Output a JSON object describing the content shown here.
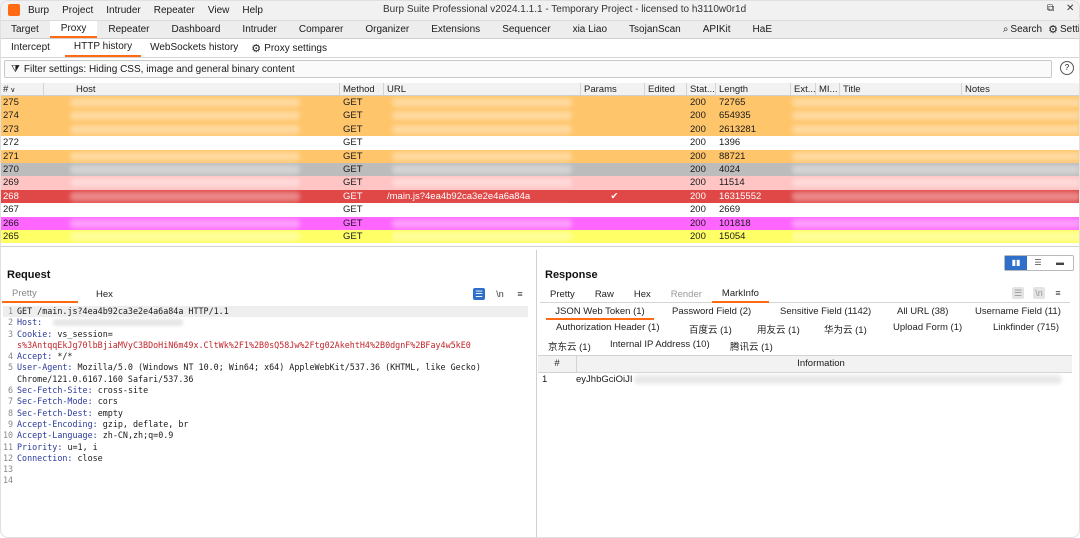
{
  "window": {
    "menu": [
      "Burp",
      "Project",
      "Intruder",
      "Repeater",
      "View",
      "Help"
    ],
    "title": "Burp Suite Professional v2024.1.1.1 - Temporary Project - licensed to h3110w0r1d",
    "controls": [
      "⧉",
      "✕"
    ]
  },
  "main_tabs": [
    "Target",
    "Proxy",
    "Repeater",
    "Dashboard",
    "Intruder",
    "Comparer",
    "Organizer",
    "Extensions",
    "Sequencer",
    "xia Liao",
    "TsojanScan",
    "APIKit",
    "HaE"
  ],
  "main_tab_active": "Proxy",
  "top_right": {
    "search_label": "Search",
    "settings_label": "Setti"
  },
  "sub_tabs": [
    "Intercept",
    "HTTP history",
    "WebSockets history"
  ],
  "proxy_settings_label": "Proxy settings",
  "filter_text": "Filter settings: Hiding CSS, image and general binary content",
  "help_icon": "?",
  "columns": [
    "#",
    "Host",
    "Method",
    "URL",
    "Params",
    "Edited",
    "Stat...",
    "Length",
    "Ext...",
    "MI...",
    "Title",
    "Notes"
  ],
  "rows": [
    {
      "num": "275",
      "method": "GET",
      "url": "",
      "params": "",
      "status": "200",
      "length": "72765",
      "color": "#ffc56a"
    },
    {
      "num": "274",
      "method": "GET",
      "url": "",
      "params": "",
      "status": "200",
      "length": "654935",
      "color": "#ffc56a"
    },
    {
      "num": "273",
      "method": "GET",
      "url": "",
      "params": "",
      "status": "200",
      "length": "2613281",
      "color": "#ffc56a"
    },
    {
      "num": "272",
      "method": "GET",
      "url": "",
      "params": "",
      "status": "200",
      "length": "1396",
      "color": "#ffffff"
    },
    {
      "num": "271",
      "method": "GET",
      "url": "",
      "params": "",
      "status": "200",
      "length": "88721",
      "color": "#ffc56a"
    },
    {
      "num": "270",
      "method": "GET",
      "url": "",
      "params": "",
      "status": "200",
      "length": "4024",
      "color": "#bcbcbc"
    },
    {
      "num": "269",
      "method": "GET",
      "url": "",
      "params": "",
      "status": "200",
      "length": "11514",
      "color": "#ffc4c4"
    },
    {
      "num": "268",
      "method": "GET",
      "url": "/main.js?4ea4b92ca3e2e4a6a84a",
      "params": "✔",
      "status": "200",
      "length": "16315552",
      "color": "#e04848",
      "selected": true
    },
    {
      "num": "267",
      "method": "GET",
      "url": "",
      "params": "",
      "status": "200",
      "length": "2669",
      "color": "#ffffff"
    },
    {
      "num": "266",
      "method": "GET",
      "url": "",
      "params": "",
      "status": "200",
      "length": "101818",
      "color": "#ff66ff"
    },
    {
      "num": "265",
      "method": "GET",
      "url": "",
      "params": "",
      "status": "200",
      "length": "15054",
      "color": "#ffff66"
    }
  ],
  "request": {
    "title": "Request",
    "tabs": [
      "Pretty",
      "Hex"
    ],
    "tool_icons": [
      "☰",
      "\\n",
      "≡"
    ],
    "lines": [
      {
        "n": "1",
        "key": "",
        "val": "GET /main.js?4ea4b92ca3e2e4a6a84a HTTP/1.1"
      },
      {
        "n": "2",
        "key": "Host:",
        "val": ""
      },
      {
        "n": "3",
        "key": "Cookie:",
        "val": "vs_session="
      },
      {
        "n": "",
        "key": "",
        "val": "s%3AntqqEkJg70lbBjiaMVyC3BDoHiN6m49x.CltWk%2F1%2B0sQ58Jw%2Ftg02AkehtH4%2B0dgnF%2BFay4w5kE0",
        "red": true
      },
      {
        "n": "4",
        "key": "Accept:",
        "val": "*/*"
      },
      {
        "n": "5",
        "key": "User-Agent:",
        "val": "Mozilla/5.0 (Windows NT 10.0; Win64; x64) AppleWebKit/537.36 (KHTML, like Gecko)"
      },
      {
        "n": "",
        "key": "",
        "val": "Chrome/121.0.6167.160 Safari/537.36"
      },
      {
        "n": "6",
        "key": "Sec-Fetch-Site:",
        "val": "cross-site"
      },
      {
        "n": "7",
        "key": "Sec-Fetch-Mode:",
        "val": "cors"
      },
      {
        "n": "8",
        "key": "Sec-Fetch-Dest:",
        "val": "empty"
      },
      {
        "n": "9",
        "key": "Accept-Encoding:",
        "val": "gzip, deflate, br"
      },
      {
        "n": "10",
        "key": "Accept-Language:",
        "val": "zh-CN,zh;q=0.9"
      },
      {
        "n": "11",
        "key": "Priority:",
        "val": "u=1, i"
      },
      {
        "n": "12",
        "key": "Connection:",
        "val": "close"
      },
      {
        "n": "13",
        "key": "",
        "val": ""
      },
      {
        "n": "14",
        "key": "",
        "val": ""
      }
    ]
  },
  "response": {
    "title": "Response",
    "tabs": [
      "Pretty",
      "Raw",
      "Hex",
      "Render",
      "MarkInfo"
    ],
    "tool_icons": [
      "☰",
      "\\n",
      "≡"
    ],
    "markinfo_tabs_row1": [
      "JSON Web Token (1)",
      "Password Field (2)",
      "Sensitive Field (1142)",
      "All URL (38)",
      "Username Field (11)"
    ],
    "markinfo_tabs_row2": [
      "Authorization Header (1)",
      "百度云 (1)",
      "用友云 (1)",
      "华为云 (1)",
      "Upload Form (1)",
      "Linkfinder (715)"
    ],
    "markinfo_tabs_row3": [
      "京东云 (1)",
      "Internal IP Address (10)",
      "腾讯云 (1)"
    ],
    "table_headers": [
      "#",
      "Information"
    ],
    "table_rows": [
      {
        "n": "1",
        "info": "eyJhbGciOiJI"
      }
    ]
  },
  "colors": {
    "accent": "#ff6a13",
    "selected_row": "#e04848"
  }
}
